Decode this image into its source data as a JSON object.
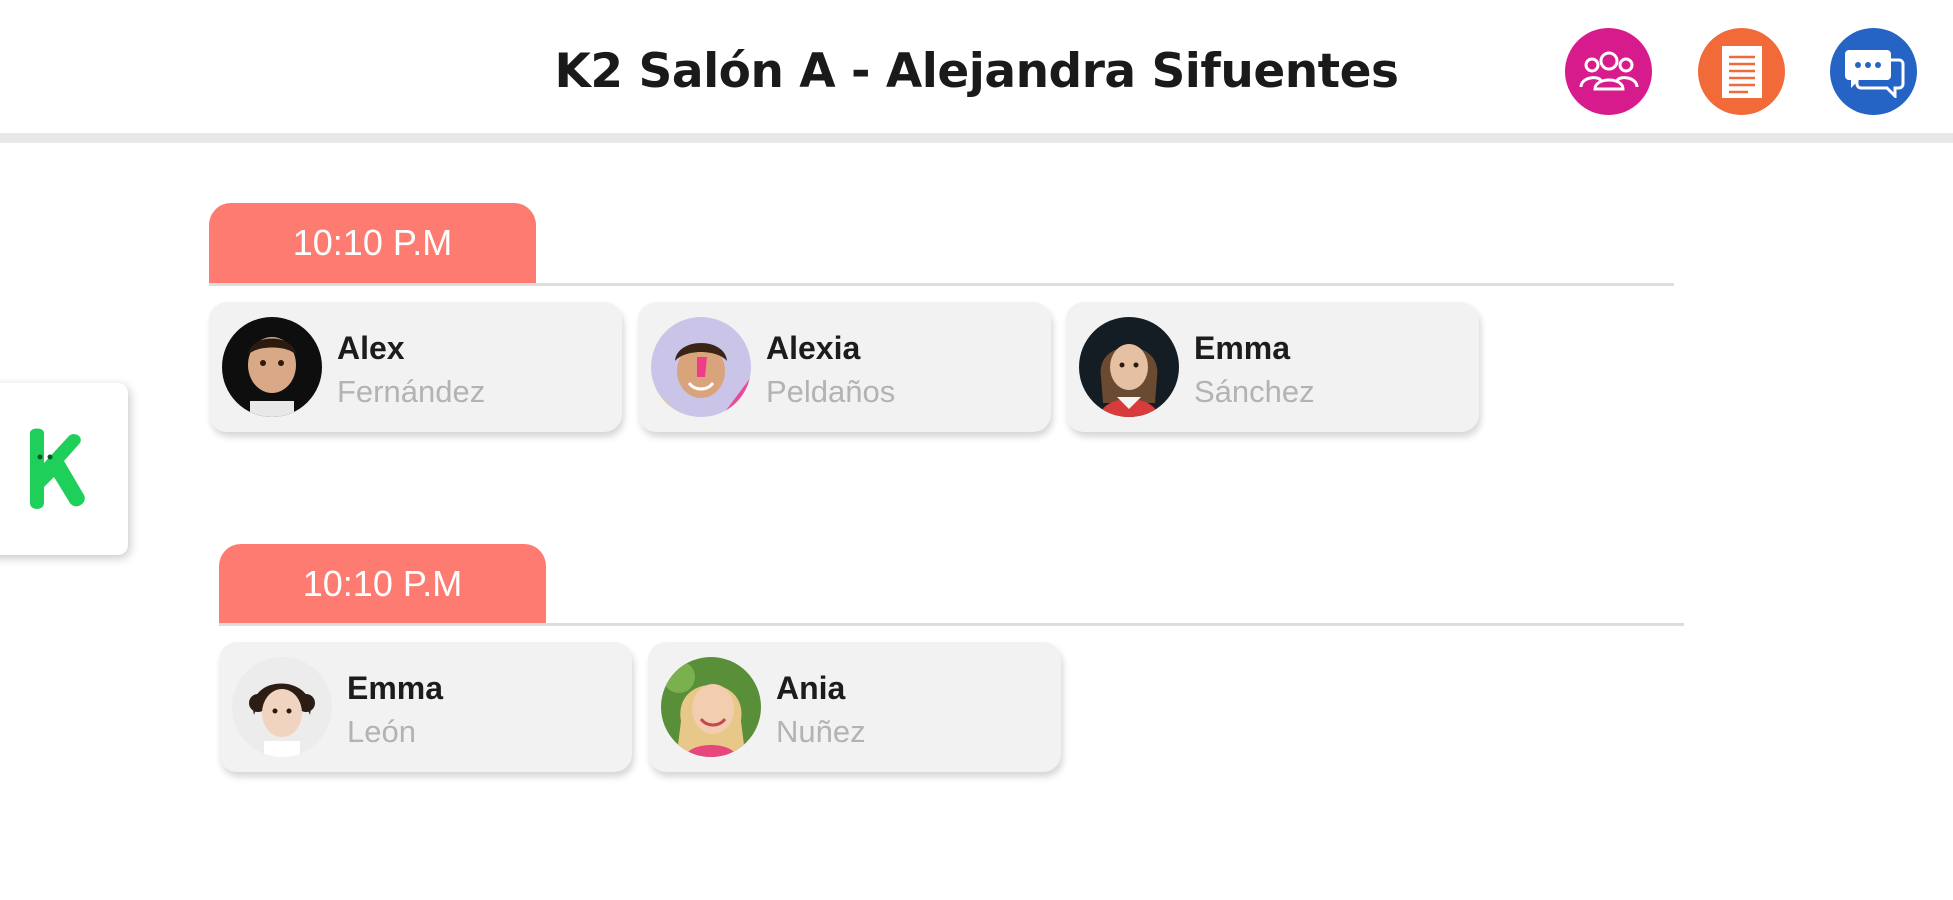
{
  "header": {
    "title": "K2 Salón A - Alejandra Sifuentes",
    "buttons": [
      {
        "icon": "group-icon",
        "color": "#d81b8c"
      },
      {
        "icon": "document-icon",
        "color": "#f26a3a"
      },
      {
        "icon": "chat-icon",
        "color": "#2563c4"
      }
    ]
  },
  "side_tab": {
    "logo_letter": "K",
    "logo_color": "#1ecf5a"
  },
  "groups": [
    {
      "time": "10:10 P.M",
      "students": [
        {
          "first": "Alex",
          "last": "Fernández"
        },
        {
          "first": "Alexia",
          "last": "Peldaños"
        },
        {
          "first": "Emma",
          "last": "Sánchez"
        }
      ]
    },
    {
      "time": "10:10 P.M",
      "students": [
        {
          "first": "Emma",
          "last": "León"
        },
        {
          "first": "Ania",
          "last": "Nuñez"
        }
      ]
    }
  ],
  "colors": {
    "time_tab": "#fd7b71",
    "card_bg": "#f2f2f2",
    "last_name": "#b3b3b3"
  }
}
